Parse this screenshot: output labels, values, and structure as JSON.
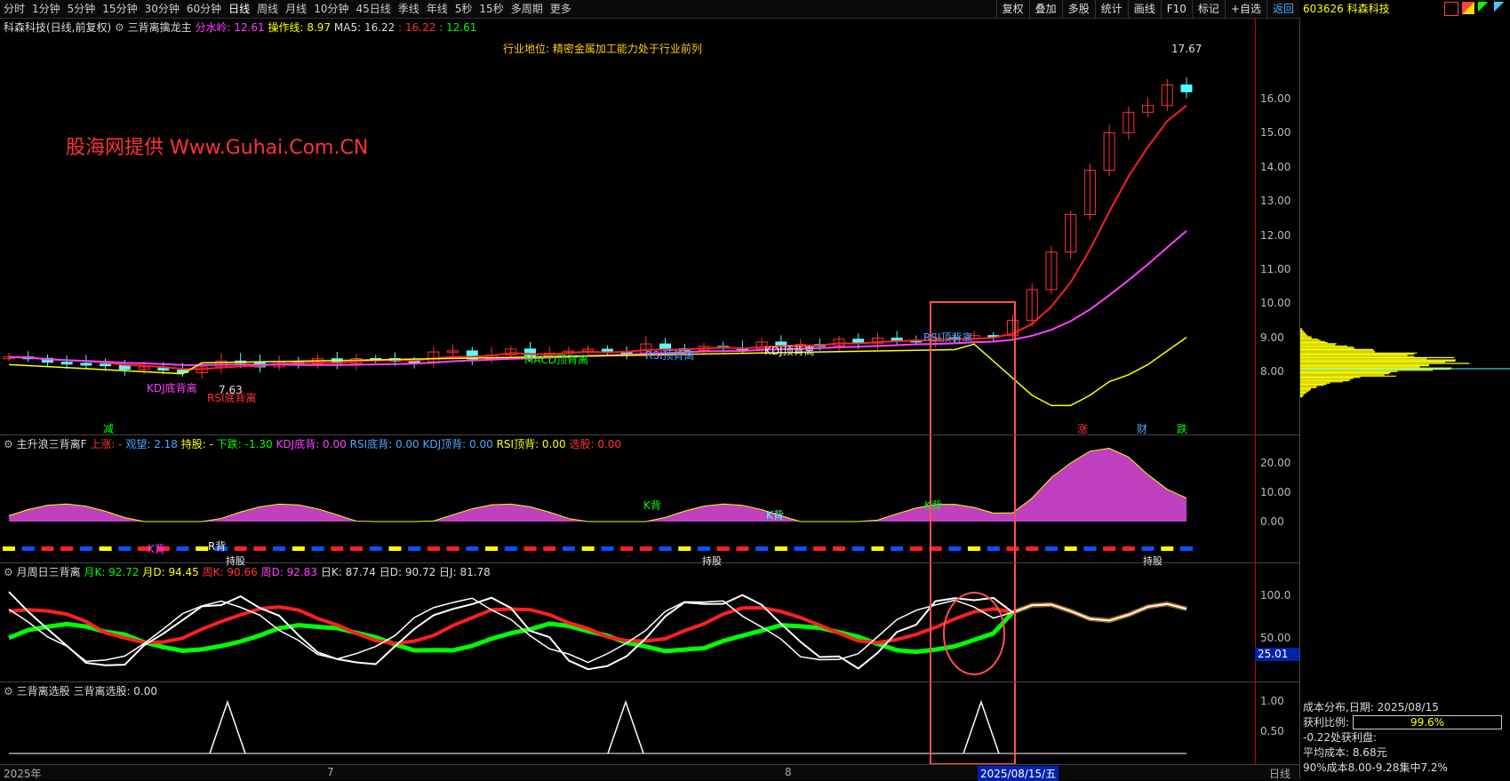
{
  "toolbar": {
    "periods": [
      "分时",
      "1分钟",
      "5分钟",
      "15分钟",
      "30分钟",
      "60分钟",
      "日线",
      "周线",
      "月线",
      "10分钟",
      "45日线",
      "季线",
      "年线",
      "5秒",
      "15秒",
      "多周期",
      "更多"
    ],
    "active_period": "日线",
    "right_buttons": [
      "复权",
      "叠加",
      "多股",
      "统计",
      "画线",
      "F10",
      "标记",
      "+自选",
      "返回"
    ]
  },
  "stock": {
    "code_name": "603626 科森科技"
  },
  "main_panel": {
    "title": "科森科技(日线,前复权)",
    "indicator_name": "三背离擒龙主",
    "fen_shui_ling": "分水岭: 12.61",
    "cao_zuo_xian": "操作线: 8.97",
    "ma5": "MA5: 16.22",
    "v1": ": 16.22",
    "v2": ": 12.61",
    "industry": "行业地位: 精密金属加工能力处于行业前列",
    "watermark": "股海网提供 Www.Guhai.Com.CN",
    "high_label": "17.67",
    "low_label": "7.63",
    "labels": {
      "kdj_bottom": "KDJ底背离",
      "rsi_bottom": "RSI底背离",
      "macd_top": "MACD顶背离",
      "rsi_top1": "RSI顶背离",
      "kdj_top": "KDJ顶背离",
      "rsi_top2": "RSI顶背离",
      "zhang": "涨",
      "cai": "财",
      "die": "跌",
      "jian": "减"
    },
    "yticks": [
      "16.00",
      "15.00",
      "14.00",
      "13.00",
      "12.00",
      "11.00",
      "10.00",
      "9.00",
      "8.00"
    ]
  },
  "panel2": {
    "title": "主升浪三背离F",
    "shang_zhang": "上涨: -",
    "guan_wang": "观望: 2.18",
    "chi_gu": "持股: -",
    "xia_die": "下跌: -1.30",
    "kdj_di": "KDJ底背: 0.00",
    "rsi_di": "RSI底背: 0.00",
    "kdj_ding": "KDJ顶背: 0.00",
    "rsi_ding": "RSI顶背: 0.00",
    "xuan_gu": "选股: 0.00",
    "yticks": [
      "20.00",
      "10.00",
      "0.00"
    ],
    "tags": {
      "k_bei": "K背",
      "r_bei": "R背",
      "chi_gu": "持股",
      "mai": "买"
    }
  },
  "panel3": {
    "title": "月周日三背离",
    "yue_k": "月K: 92.72",
    "yue_d": "月D: 94.45",
    "zhou_k": "周K: 90.66",
    "zhou_d": "周D: 92.83",
    "ri_k": "日K: 87.74",
    "ri_d": "日D: 90.72",
    "ri_j": "日J: 81.78",
    "yticks": [
      "100.0",
      "50.00"
    ],
    "current": "25.01"
  },
  "panel4": {
    "title": "三背离选股",
    "value": "三背离选股: 0.00",
    "yticks": [
      "1.00",
      "0.50"
    ]
  },
  "xaxis": {
    "labels": [
      "2025年",
      "7",
      "8"
    ],
    "cursor_date": "2025/08/15/五",
    "period": "日线"
  },
  "cost": {
    "title": "成本分布,日期: 2025/08/15",
    "profit_label": "获利比例:",
    "profit_value": "99.6%",
    "profit_at": "-0.22处获利盘:",
    "avg_cost": "平均成本: 8.68元",
    "concentration": "90%成本8.00-9.28集中7.2%"
  },
  "colors": {
    "up": "#ff3333",
    "down": "#54ffff",
    "ma_red": "#ff2020",
    "ma_magenta": "#ff40ff",
    "yellow": "#ffff00",
    "green": "#00ff00"
  }
}
